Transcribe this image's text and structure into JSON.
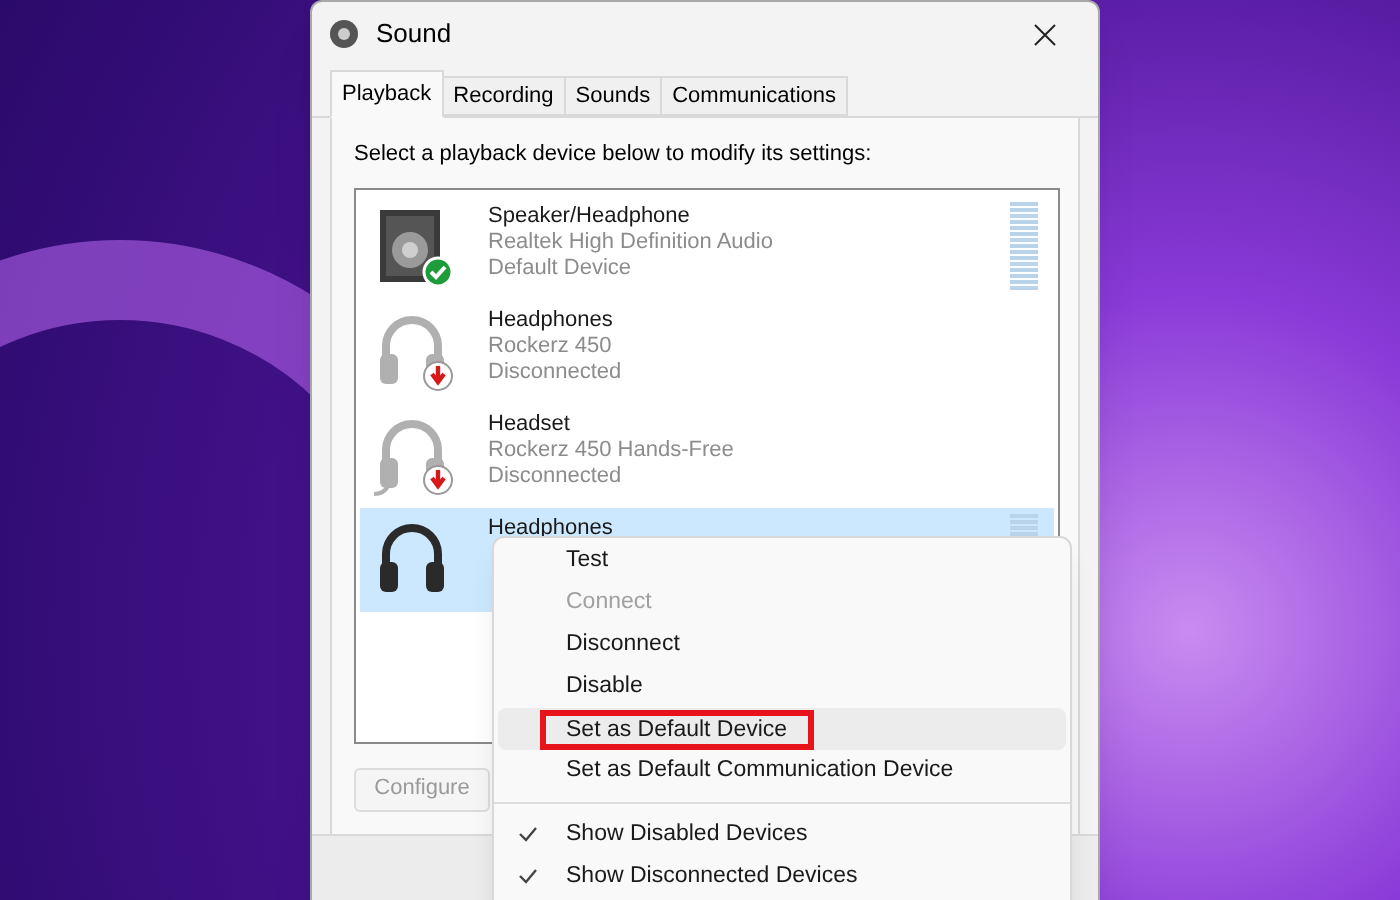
{
  "window": {
    "title": "Sound"
  },
  "tabs": [
    {
      "label": "Playback",
      "selected": true
    },
    {
      "label": "Recording",
      "selected": false
    },
    {
      "label": "Sounds",
      "selected": false
    },
    {
      "label": "Communications",
      "selected": false
    }
  ],
  "instruction": "Select a playback device below to modify its settings:",
  "devices": [
    {
      "name": "Speaker/Headphone",
      "lines": [
        "Realtek High Definition Audio",
        "Default Device"
      ],
      "kind": "speaker",
      "default": true,
      "disconnected": false,
      "selected": false,
      "meter": true
    },
    {
      "name": "Headphones",
      "lines": [
        "Rockerz 450",
        "Disconnected"
      ],
      "kind": "headphones",
      "default": false,
      "disconnected": true,
      "selected": false,
      "meter": false
    },
    {
      "name": "Headset",
      "lines": [
        "Rockerz 450 Hands-Free",
        "Disconnected"
      ],
      "kind": "headset",
      "default": false,
      "disconnected": true,
      "selected": false,
      "meter": false
    },
    {
      "name": "Headphones",
      "kind": "headphones",
      "default": false,
      "disconnected": false,
      "selected": true,
      "meter": true
    }
  ],
  "buttons": [
    {
      "label": "Configure",
      "disabled": true
    }
  ],
  "context_menu": [
    {
      "label": "Test",
      "kind": "item",
      "disabled": false,
      "hovered": false,
      "outlined": false
    },
    {
      "label": "Connect",
      "kind": "item",
      "disabled": true,
      "hovered": false,
      "outlined": false
    },
    {
      "label": "Disconnect",
      "kind": "item",
      "disabled": false,
      "hovered": false,
      "outlined": false
    },
    {
      "label": "Disable",
      "kind": "item",
      "disabled": false,
      "hovered": false,
      "outlined": false
    },
    {
      "label": "Set as Default Device",
      "kind": "item",
      "disabled": false,
      "hovered": true,
      "outlined": true
    },
    {
      "label": "Set as Default Communication Device",
      "kind": "item",
      "disabled": false,
      "hovered": false,
      "outlined": false
    },
    {
      "kind": "separator"
    },
    {
      "label": "Show Disabled Devices",
      "kind": "check",
      "checked": true,
      "disabled": false,
      "hovered": false,
      "outlined": false
    },
    {
      "label": "Show Disconnected Devices",
      "kind": "check",
      "checked": true,
      "disabled": false,
      "hovered": false,
      "outlined": false
    }
  ]
}
